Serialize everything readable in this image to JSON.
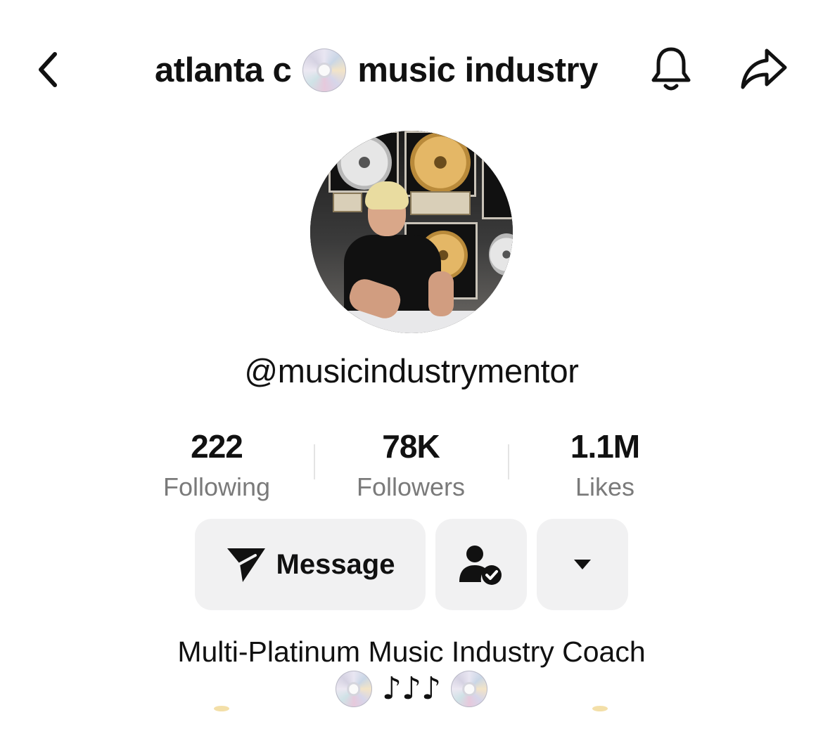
{
  "header": {
    "title_prefix": "atlanta c",
    "title_disc_icon": "disc-icon",
    "title_suffix": "music industry",
    "back_icon": "chevron-left-icon",
    "bell_icon": "bell-icon",
    "share_icon": "share-arrow-icon"
  },
  "profile": {
    "handle": "@musicindustrymentor",
    "avatar": "profile-photo"
  },
  "stats": [
    {
      "value": "222",
      "label": "Following"
    },
    {
      "value": "78K",
      "label": "Followers"
    },
    {
      "value": "1.1M",
      "label": "Likes"
    }
  ],
  "actions": {
    "message_label": "Message",
    "message_icon": "send-icon",
    "follow_icon": "person-check-icon",
    "more_icon": "caret-down-icon"
  },
  "bio": {
    "text": "Multi-Platinum Music Industry Coach",
    "emoji_notes": "♪♪♪",
    "emoji_disc": "disc-icon"
  }
}
